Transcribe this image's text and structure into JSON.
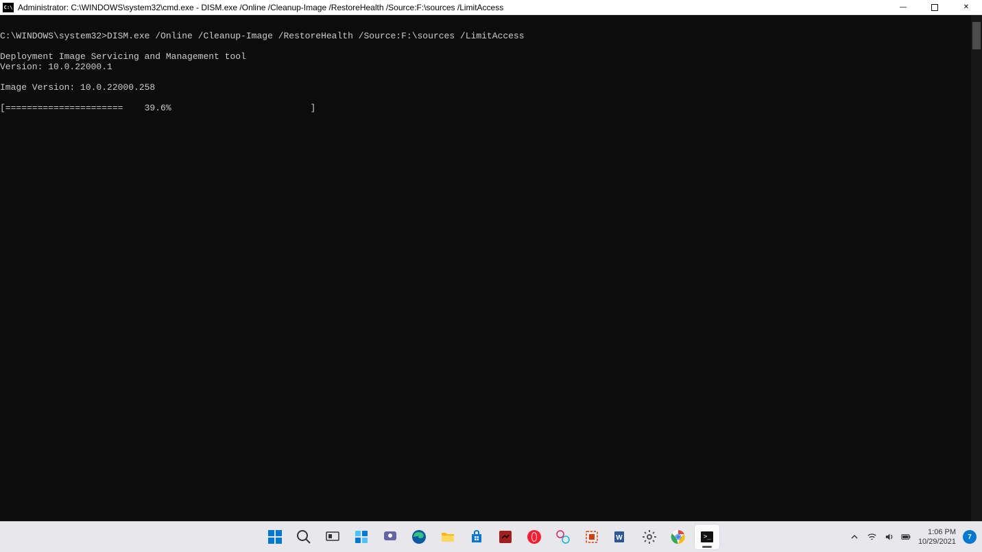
{
  "titlebar": {
    "icon_text": "C:\\",
    "title": "Administrator: C:\\WINDOWS\\system32\\cmd.exe - DISM.exe  /Online /Cleanup-Image /RestoreHealth /Source:F:\\sources /LimitAccess",
    "buttons": {
      "minimize": "—",
      "maximize": "▢",
      "close": "✕"
    }
  },
  "terminal": {
    "line_prompt": "C:\\WINDOWS\\system32>DISM.exe /Online /Cleanup-Image /RestoreHealth /Source:F:\\sources /LimitAccess",
    "line_tool": "Deployment Image Servicing and Management tool",
    "line_version": "Version: 10.0.22000.1",
    "line_imgver": "Image Version: 10.0.22000.258",
    "line_progress": "[======================    39.6%                          ]"
  },
  "taskbar": {
    "icons": [
      {
        "name": "start",
        "color": "#0078d4"
      },
      {
        "name": "search",
        "color": "#333"
      },
      {
        "name": "task-view",
        "color": "#555"
      },
      {
        "name": "widgets",
        "color": "#0078d4"
      },
      {
        "name": "chat",
        "color": "#6264a7"
      },
      {
        "name": "edge",
        "color": "#0078d4"
      },
      {
        "name": "file-explorer",
        "color": "#ffb900"
      },
      {
        "name": "store",
        "color": "#0078d4"
      },
      {
        "name": "app-red",
        "color": "#c0392b"
      },
      {
        "name": "opera",
        "color": "#ff1b2d"
      },
      {
        "name": "app-pink",
        "color": "#e91e63"
      },
      {
        "name": "snip",
        "color": "#d83b01"
      },
      {
        "name": "word",
        "color": "#2b579a"
      },
      {
        "name": "settings",
        "color": "#555"
      },
      {
        "name": "chrome",
        "color": "#4285f4"
      },
      {
        "name": "terminal",
        "color": "#111"
      }
    ],
    "tray": {
      "chevron": "^",
      "wifi": "wifi",
      "volume": "vol",
      "battery": "bat"
    },
    "clock": {
      "time": "1:06 PM",
      "date": "10/29/2021"
    },
    "notif_count": "7"
  }
}
